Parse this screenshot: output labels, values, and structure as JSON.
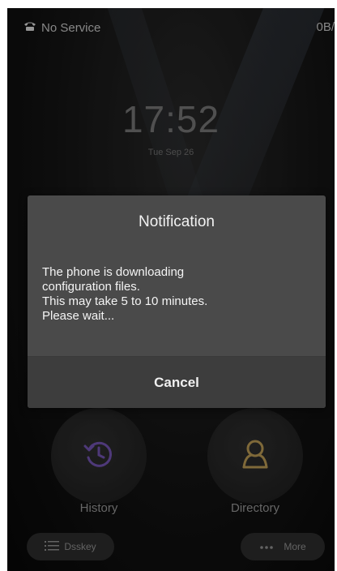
{
  "status_bar": {
    "network_label": "No Service",
    "right_text": "0B/"
  },
  "clock": {
    "time": "17:52",
    "date": "Tue Sep 26"
  },
  "dialog": {
    "title": "Notification",
    "message_lines": [
      "The phone is downloading",
      "configuration files.",
      "This may take 5 to 10 minutes.",
      "Please wait..."
    ],
    "cancel_label": "Cancel"
  },
  "apps": [
    {
      "label": "History",
      "icon": "history-icon",
      "accent": "#6d4fa8"
    },
    {
      "label": "Directory",
      "icon": "contact-icon",
      "accent": "#b0924f"
    }
  ],
  "bottom_bar": {
    "dsskey_label": "Dsskey",
    "more_label": "More"
  }
}
